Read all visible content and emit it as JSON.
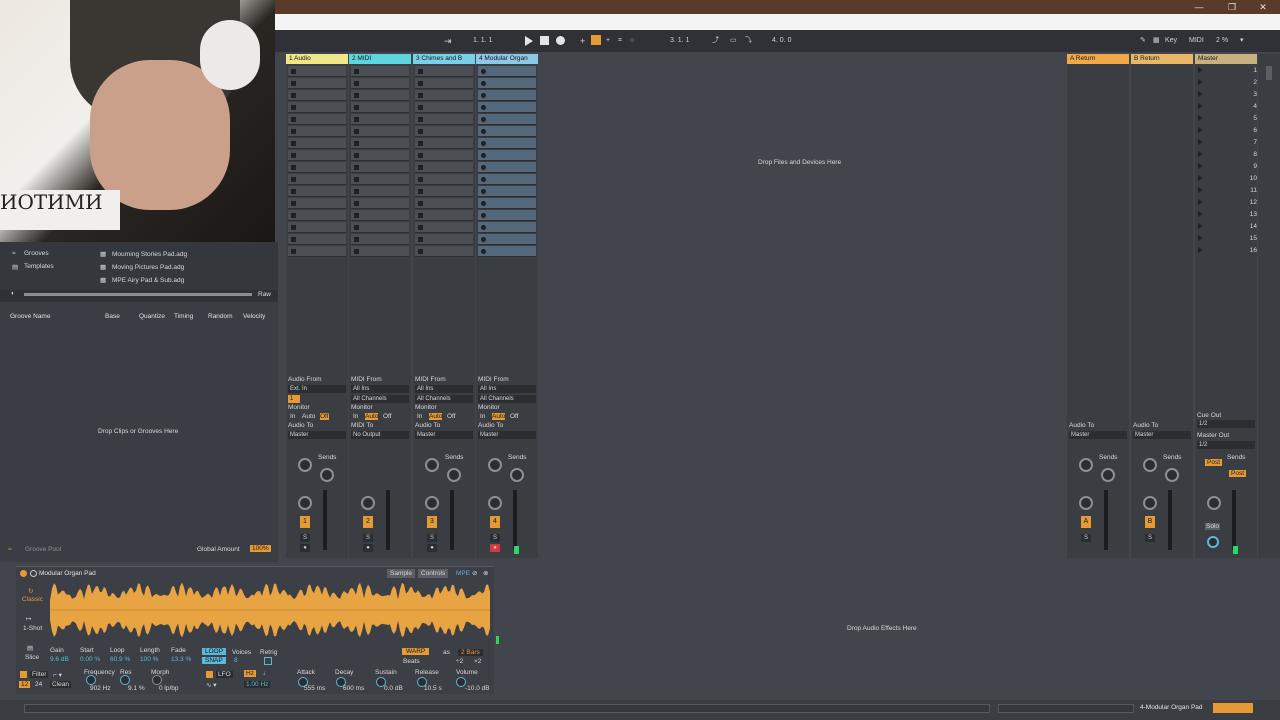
{
  "window": {
    "min_label": "—",
    "max_label": "❐",
    "close_label": "✕"
  },
  "transport": {
    "position": "1.   1.   1",
    "loop_start": "3.   1.   1",
    "loop_length": "4.   0.   0",
    "key_label": "Key",
    "midi_label": "MIDI",
    "cpu": "2 %"
  },
  "browser": {
    "places": [
      {
        "label": "Grooves"
      },
      {
        "label": "Templates"
      }
    ],
    "files": [
      {
        "label": "Mourning Stories Pad.adg"
      },
      {
        "label": "Moving Pictures Pad.adg"
      },
      {
        "label": "MPE Airy Pad & Sub.adg"
      }
    ],
    "raw_label": "Raw"
  },
  "groove_pool": {
    "columns": [
      "Groove Name",
      "Base",
      "Quantize",
      "Timing",
      "Random",
      "Velocity"
    ],
    "drop_hint": "Drop Clips or Grooves Here",
    "footer_label": "Groove Pool",
    "global_amount_label": "Global Amount",
    "global_amount_value": "100%"
  },
  "session": {
    "drop_hint": "Drop Files and Devices Here",
    "tracks": [
      {
        "name": "1 Audio",
        "color": "#f0e68a",
        "from_label": "Audio From",
        "from_value": "Ext. In",
        "channel": "1",
        "monitor_label": "Monitor",
        "mon_in": "In",
        "mon_auto": "Auto",
        "mon_off": "Off",
        "to_label": "Audio To",
        "to_value": "Master",
        "sends_label": "Sends",
        "num": "1",
        "s": "S"
      },
      {
        "name": "2 MIDI",
        "color": "#5ed6e0",
        "from_label": "MIDI From",
        "from_value": "All Ins",
        "channel": "All Channels",
        "monitor_label": "Monitor",
        "mon_in": "In",
        "mon_auto": "Auto",
        "mon_off": "Off",
        "to_label": "MIDI To",
        "to_value": "No Output",
        "sends_label": "",
        "num": "2",
        "s": "S"
      },
      {
        "name": "3 Chimes and B",
        "color": "#7ad0e8",
        "from_label": "MIDI From",
        "from_value": "All Ins",
        "channel": "All Channels",
        "monitor_label": "Monitor",
        "mon_in": "In",
        "mon_auto": "Auto",
        "mon_off": "Off",
        "to_label": "Audio To",
        "to_value": "Master",
        "sends_label": "Sends",
        "num": "3",
        "s": "S"
      },
      {
        "name": "4 Modular Organ",
        "color": "#8ec8e8",
        "from_label": "MIDI From",
        "from_value": "All Ins",
        "channel": "All Channels",
        "monitor_label": "Monitor",
        "mon_in": "In",
        "mon_auto": "Auto",
        "mon_off": "Off",
        "to_label": "Audio To",
        "to_value": "Master",
        "sends_label": "Sends",
        "num": "4",
        "s": "S"
      }
    ],
    "returns": [
      {
        "name": "A Return",
        "color": "#f0a84a",
        "to_label": "Audio To",
        "to_value": "Master",
        "sends_label": "Sends",
        "num": "A",
        "s": "S"
      },
      {
        "name": "B Return",
        "color": "#e8b868",
        "to_label": "Audio To",
        "to_value": "Master",
        "sends_label": "Sends",
        "num": "B",
        "s": "S"
      }
    ],
    "master": {
      "name": "Master",
      "color": "#c8b080",
      "cue_label": "Cue Out",
      "cue_value": "1/2",
      "out_label": "Master Out",
      "out_value": "1/2",
      "sends_label": "Sends",
      "post1": "Post",
      "post2": "Post",
      "solo": "Solo"
    },
    "scenes": [
      "1",
      "2",
      "3",
      "4",
      "5",
      "6",
      "7",
      "8",
      "9",
      "10",
      "11",
      "12",
      "13",
      "14",
      "15",
      "16"
    ]
  },
  "device": {
    "name": "Modular Organ Pad",
    "tab_sample": "Sample",
    "tab_controls": "Controls",
    "tab_mpe": "MPE",
    "modes": [
      "Classic",
      "1-Shot",
      "Slice"
    ],
    "params": [
      {
        "label": "Gain",
        "value": "9.6 dB"
      },
      {
        "label": "Start",
        "value": "0.00 %"
      },
      {
        "label": "Loop",
        "value": "60.9 %"
      },
      {
        "label": "Length",
        "value": "100 %"
      },
      {
        "label": "Fade",
        "value": "13.3 %"
      }
    ],
    "loop_btn": "LOOP",
    "snap_btn": "SNAP",
    "voices_label": "Voices",
    "voices_value": "8",
    "retrig_label": "Retrig",
    "warp_btn": "WARP",
    "as_label": "as",
    "bars_value": "2 Bars",
    "beats_value": "Beats",
    "half": "÷2",
    "double": "×2",
    "filter_label": "Filter",
    "filter_slope": "12",
    "filter_db": "24",
    "filter_type": "Clean",
    "freq_label": "Frequency",
    "freq_value": "902 Hz",
    "res_label": "Res",
    "res_value": "9.1 %",
    "morph_label": "Morph",
    "morph_value": "0 lp/bp",
    "lfo_label": "LFO",
    "lfo_hz": "Hz",
    "lfo_rate": "1.00 Hz",
    "attack_label": "Attack",
    "attack_value": "555 ms",
    "decay_label": "Decay",
    "decay_value": "600 ms",
    "sustain_label": "Sustain",
    "sustain_value": "0.0 dB",
    "release_label": "Release",
    "release_value": "10.5 s",
    "volume_label": "Volume",
    "volume_value": "-10.0 dB"
  },
  "fx_drop_hint": "Drop Audio Effects Here",
  "status": {
    "track_name": "4-Modular Organ Pad"
  }
}
